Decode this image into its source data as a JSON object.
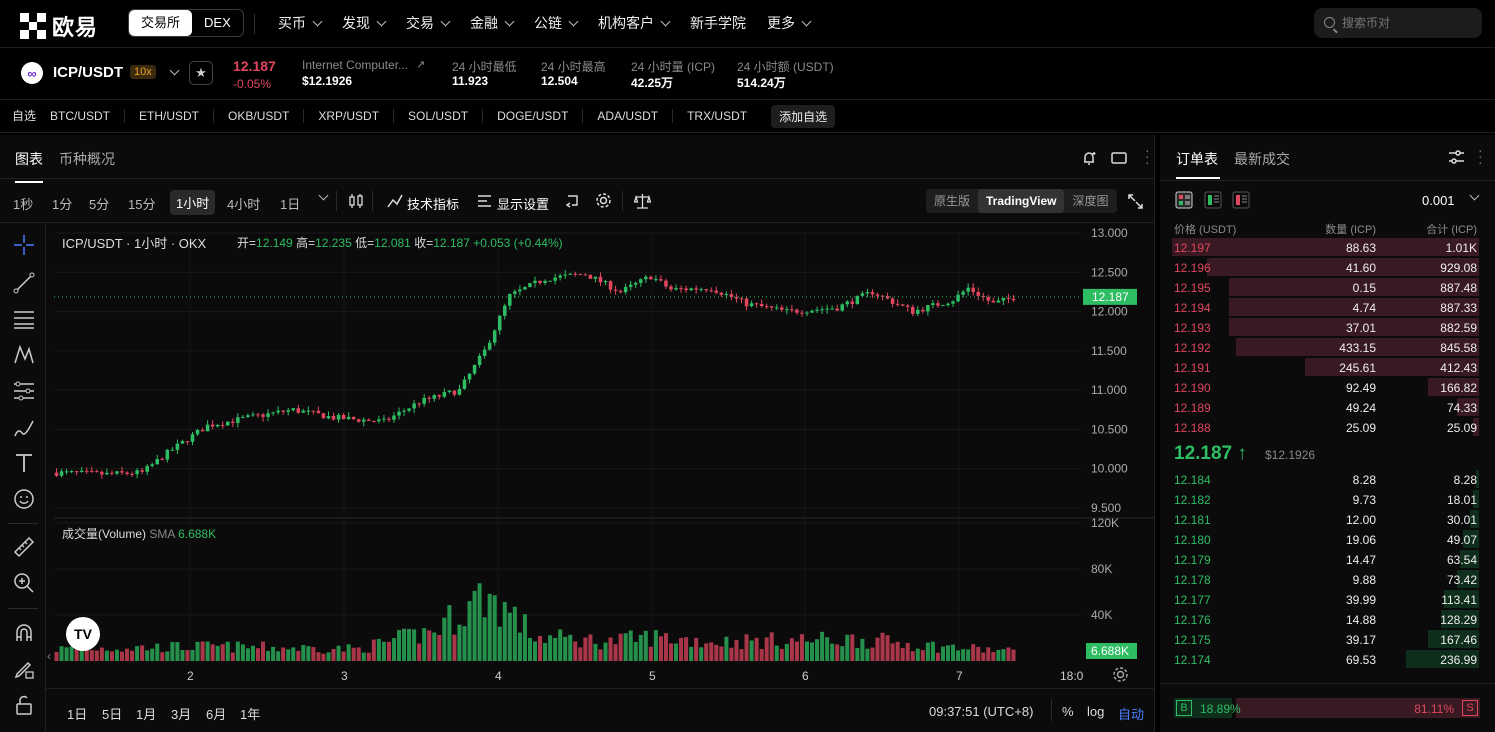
{
  "top": {
    "brand": "欧易",
    "seg": [
      "交易所",
      "DEX"
    ],
    "nav": [
      "买币",
      "发现",
      "交易",
      "金融",
      "公链",
      "机构客户",
      "新手学院",
      "更多"
    ],
    "nav_chev": [
      true,
      true,
      true,
      true,
      true,
      true,
      false,
      true
    ],
    "search_placeholder": "搜索币对"
  },
  "ticker": {
    "pair": "ICP/USDT",
    "leverage": "10x",
    "price": "12.187",
    "change": "-0.05%",
    "name": "Internet Computer...",
    "usd_price": "$12.1926",
    "stats": [
      {
        "label": "24 小时最低",
        "value": "11.923"
      },
      {
        "label": "24 小时最高",
        "value": "12.504"
      },
      {
        "label": "24 小时量 (ICP)",
        "value": "42.25万"
      },
      {
        "label": "24 小时额 (USDT)",
        "value": "514.24万"
      }
    ]
  },
  "pairs": {
    "fav": "自选",
    "list": [
      "BTC/USDT",
      "ETH/USDT",
      "OKB/USDT",
      "XRP/USDT",
      "SOL/USDT",
      "DOGE/USDT",
      "ADA/USDT",
      "TRX/USDT"
    ],
    "add": "添加自选"
  },
  "chart_tabs": [
    "图表",
    "币种概况"
  ],
  "toolbar": {
    "timeframes": [
      "1秒",
      "1分",
      "5分",
      "15分",
      "1小时",
      "4小时",
      "1日"
    ],
    "active": 4,
    "indicators": "技术指标",
    "display": "显示设置",
    "views": [
      "原生版",
      "TradingView",
      "深度图"
    ],
    "active_view": 1
  },
  "chart_data": {
    "type": "candlestick",
    "title": "ICP/USDT · 1小时 · OKX",
    "ohlc": {
      "open_label": "开=",
      "open": "12.149",
      "high_label": "高=",
      "high": "12.235",
      "low_label": "低=",
      "low": "12.081",
      "close_label": "收=",
      "close": "12.187",
      "change": "+0.053 (+0.44%)"
    },
    "y_ticks": [
      "13.000",
      "12.500",
      "12.000",
      "11.500",
      "11.000",
      "10.500",
      "10.000",
      "9.500"
    ],
    "y_range": [
      9.5,
      13.0
    ],
    "last_price": "12.187",
    "x_ticks": [
      "2",
      "3",
      "4",
      "5",
      "6",
      "7"
    ],
    "x_end": "18:0",
    "volume_label": "成交量(Volume)",
    "sma_label": "SMA",
    "sma_value": "6.688K",
    "vol_ticks": [
      "120K",
      "80K",
      "40K"
    ],
    "vol_last": "6.688K",
    "segments": [
      [
        0,
        9.95
      ],
      [
        10,
        9.93
      ],
      [
        17,
        9.95
      ],
      [
        22,
        10.2
      ],
      [
        30,
        10.55
      ],
      [
        38,
        10.65
      ],
      [
        47,
        10.75
      ],
      [
        55,
        10.65
      ],
      [
        65,
        10.6
      ],
      [
        72,
        10.85
      ],
      [
        80,
        11.0
      ],
      [
        85,
        11.5
      ],
      [
        90,
        12.2
      ],
      [
        97,
        12.42
      ],
      [
        105,
        12.48
      ],
      [
        112,
        12.25
      ],
      [
        118,
        12.45
      ],
      [
        122,
        12.28
      ],
      [
        130,
        12.3
      ],
      [
        137,
        12.1
      ],
      [
        145,
        12.0
      ],
      [
        155,
        12.05
      ],
      [
        162,
        12.25
      ],
      [
        170,
        12.0
      ],
      [
        178,
        12.15
      ],
      [
        181,
        12.3
      ],
      [
        186,
        12.1
      ],
      [
        190,
        12.18
      ]
    ],
    "volume_segments": [
      [
        0,
        10
      ],
      [
        30,
        12
      ],
      [
        60,
        10
      ],
      [
        75,
        25
      ],
      [
        85,
        55
      ],
      [
        90,
        40
      ],
      [
        95,
        20
      ],
      [
        110,
        16
      ],
      [
        118,
        20
      ],
      [
        130,
        16
      ],
      [
        160,
        18
      ],
      [
        175,
        12
      ],
      [
        190,
        8
      ]
    ]
  },
  "bottom": {
    "ranges": [
      "1日",
      "5日",
      "1月",
      "3月",
      "6月",
      "1年"
    ],
    "time": "09:37:51 (UTC+8)",
    "pct": "%",
    "log": "log",
    "auto": "自动"
  },
  "orderbook": {
    "tabs": [
      "订单表",
      "最新成交"
    ],
    "precision": "0.001",
    "headers": [
      "价格 (USDT)",
      "数量 (ICP)",
      "合计 (ICP)"
    ],
    "asks": [
      {
        "price": "12.197",
        "qty": "88.63",
        "total": "1.01K",
        "depth": 0.97
      },
      {
        "price": "12.196",
        "qty": "41.60",
        "total": "929.08",
        "depth": 0.86
      },
      {
        "price": "12.195",
        "qty": "0.15",
        "total": "887.48",
        "depth": 0.79
      },
      {
        "price": "12.194",
        "qty": "4.74",
        "total": "887.33",
        "depth": 0.79
      },
      {
        "price": "12.193",
        "qty": "37.01",
        "total": "882.59",
        "depth": 0.79
      },
      {
        "price": "12.192",
        "qty": "433.15",
        "total": "845.58",
        "depth": 0.77
      },
      {
        "price": "12.191",
        "qty": "245.61",
        "total": "412.43",
        "depth": 0.55
      },
      {
        "price": "12.190",
        "qty": "92.49",
        "total": "166.82",
        "depth": 0.16
      },
      {
        "price": "12.189",
        "qty": "49.24",
        "total": "74.33",
        "depth": 0.07
      },
      {
        "price": "12.188",
        "qty": "25.09",
        "total": "25.09",
        "depth": 0.02
      }
    ],
    "mid_price": "12.187",
    "mid_usd": "$12.1926",
    "bids": [
      {
        "price": "12.184",
        "qty": "8.28",
        "total": "8.28",
        "depth": 0.01
      },
      {
        "price": "12.182",
        "qty": "9.73",
        "total": "18.01",
        "depth": 0.02
      },
      {
        "price": "12.181",
        "qty": "12.00",
        "total": "30.01",
        "depth": 0.03
      },
      {
        "price": "12.180",
        "qty": "19.06",
        "total": "49.07",
        "depth": 0.05
      },
      {
        "price": "12.179",
        "qty": "14.47",
        "total": "63.54",
        "depth": 0.06
      },
      {
        "price": "12.178",
        "qty": "9.88",
        "total": "73.42",
        "depth": 0.07
      },
      {
        "price": "12.177",
        "qty": "39.99",
        "total": "113.41",
        "depth": 0.11
      },
      {
        "price": "12.176",
        "qty": "14.88",
        "total": "128.29",
        "depth": 0.12
      },
      {
        "price": "12.175",
        "qty": "39.17",
        "total": "167.46",
        "depth": 0.16
      },
      {
        "price": "12.174",
        "qty": "69.53",
        "total": "236.99",
        "depth": 0.23
      }
    ],
    "buy_label": "B",
    "buy_pct": "18.89%",
    "buy_ratio": 0.1889,
    "sell_pct": "81.11%",
    "sell_label": "S"
  },
  "colors": {
    "up": "#2ebd63",
    "down": "#e0475f",
    "bg": "#0b0b0b"
  }
}
